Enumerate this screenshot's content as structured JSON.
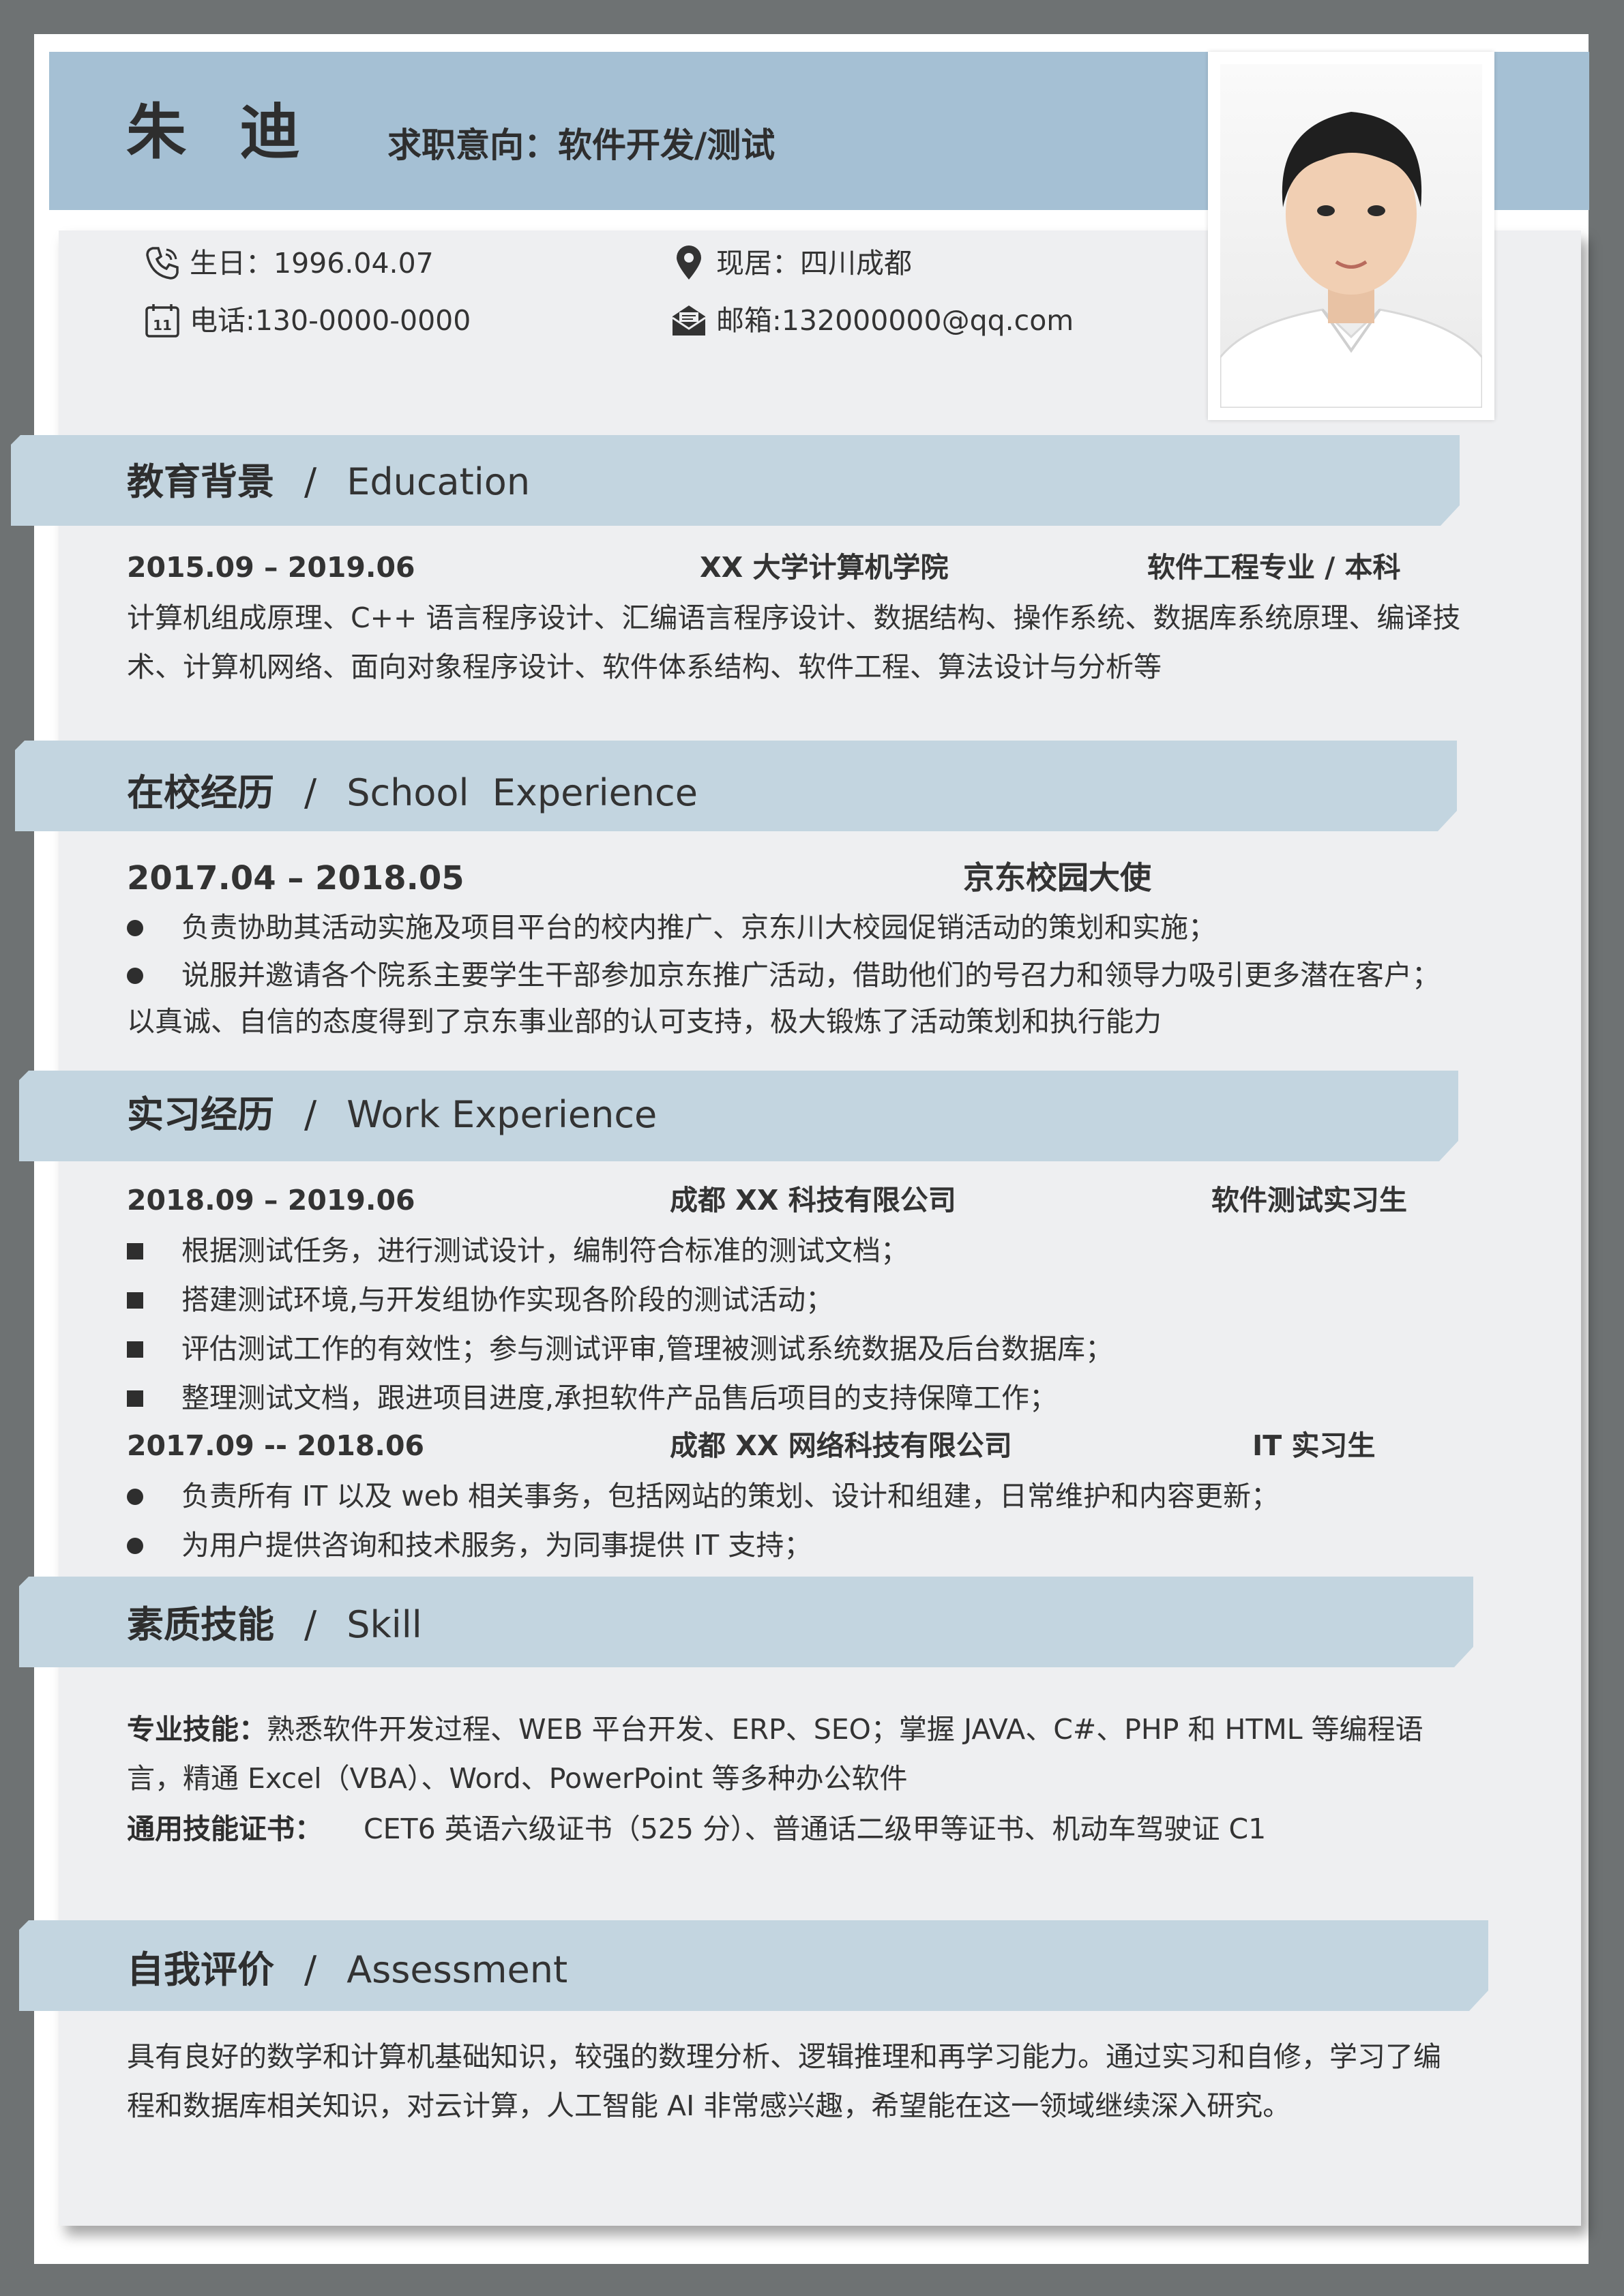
{
  "header": {
    "name": "朱 迪",
    "intent": "求职意向：软件开发/测试"
  },
  "info": {
    "birthday": "生日：1996.04.07",
    "residence": "现居：四川成都",
    "phone": "电话:130-0000-0000",
    "email": "邮箱:132000000@qq.com"
  },
  "education": {
    "title_cn": "教育背景",
    "slash": "/",
    "title_en": "Education",
    "period": "2015.09 – 2019.06",
    "school": "XX 大学计算机学院",
    "major": "软件工程专业 / 本科",
    "courses": "计算机组成原理、C++ 语言程序设计、汇编语言程序设计、数据结构、操作系统、数据库系统原理、编译技术、计算机网络、面向对象程序设计、软件体系结构、软件工程、算法设计与分析等"
  },
  "school_exp": {
    "title_cn": "在校经历",
    "slash": "/",
    "title_en": "School  Experience",
    "period": "2017.04 – 2018.05",
    "role": "京东校园大使",
    "bullets": [
      "负责协助其活动实施及项目平台的校内推广、京东川大校园促销活动的策划和实施；",
      "说服并邀请各个院系主要学生干部参加京东推广活动，借助他们的号召力和领导力吸引更多潜在客户；"
    ],
    "summary": "以真诚、自信的态度得到了京东事业部的认可支持，极大锻炼了活动策划和执行能力"
  },
  "work_exp": {
    "title_cn": "实习经历",
    "slash": "/",
    "title_en": "Work Experience",
    "jobs": [
      {
        "period": "2018.09 – 2019.06",
        "company": "成都 XX 科技有限公司",
        "role": "软件测试实习生",
        "bullets": [
          "根据测试任务，进行测试设计，编制符合标准的测试文档；",
          "搭建测试环境,与开发组协作实现各阶段的测试活动；",
          "评估测试工作的有效性；参与测试评审,管理被测试系统数据及后台数据库；",
          "整理测试文档，跟进项目进度,承担软件产品售后项目的支持保障工作；"
        ]
      },
      {
        "period": "2017.09 -- 2018.06",
        "company": "成都 XX 网络科技有限公司",
        "role": "IT 实习生",
        "bullets": [
          "负责所有 IT 以及 web 相关事务，包括网站的策划、设计和组建，日常维护和内容更新；",
          "为用户提供咨询和技术服务，为同事提供 IT 支持；"
        ]
      }
    ]
  },
  "skill": {
    "title_cn": "素质技能",
    "slash": "/",
    "title_en": "Skill",
    "pro_label": "专业技能：",
    "pro_text": "熟悉软件开发过程、WEB 平台开发、ERP、SEO；掌握 JAVA、C#、PHP 和 HTML 等编程语言，精通 Excel（VBA）、Word、PowerPoint 等多种办公软件",
    "cert_label": "通用技能证书：",
    "cert_text": "CET6  英语六级证书（525 分）、普通话二级甲等证书、机动车驾驶证 C1"
  },
  "assessment": {
    "title_cn": "自我评价",
    "slash": "/",
    "title_en": "Assessment",
    "text": "具有良好的数学和计算机基础知识，较强的数理分析、逻辑推理和再学习能力。通过实习和自修，学习了编程和数据库相关知识，对云计算，人工智能 AI 非常感兴趣，希望能在这一领域继续深入研究。"
  },
  "icons": {
    "phone": "phone-icon",
    "calendar": "calendar-icon",
    "location": "location-pin-icon",
    "email": "envelope-icon"
  },
  "colors": {
    "hero_band": "#a5c0d4",
    "section_band": "#c3d5e0",
    "sheet": "#eeeff1",
    "frame": "#6e7273"
  }
}
